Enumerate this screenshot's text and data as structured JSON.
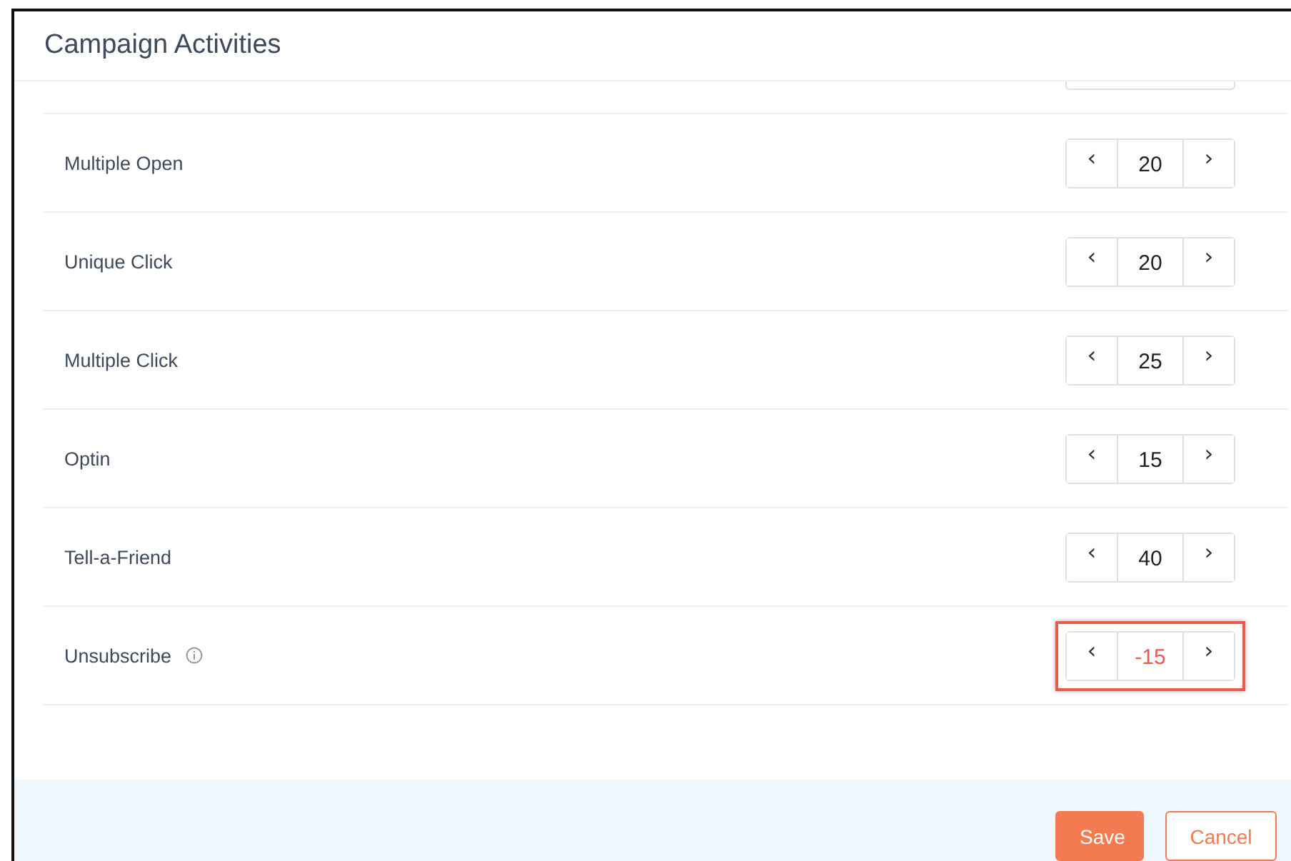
{
  "window": {
    "title": "Campaign Activities"
  },
  "rows": [
    {
      "label": "Multiple Open",
      "value": "20",
      "info": false,
      "highlighted": false
    },
    {
      "label": "Unique Click",
      "value": "20",
      "info": false,
      "highlighted": false
    },
    {
      "label": "Multiple Click",
      "value": "25",
      "info": false,
      "highlighted": false
    },
    {
      "label": "Optin",
      "value": "15",
      "info": false,
      "highlighted": false
    },
    {
      "label": "Tell-a-Friend",
      "value": "40",
      "info": false,
      "highlighted": false
    },
    {
      "label": "Unsubscribe",
      "value": "-15",
      "info": true,
      "highlighted": true
    }
  ],
  "stepper": {
    "decrease": "‹",
    "increase": "›"
  },
  "buttons": [
    {
      "label": "Save",
      "kind": "primary"
    },
    {
      "label": "Cancel",
      "kind": "secondary"
    }
  ]
}
